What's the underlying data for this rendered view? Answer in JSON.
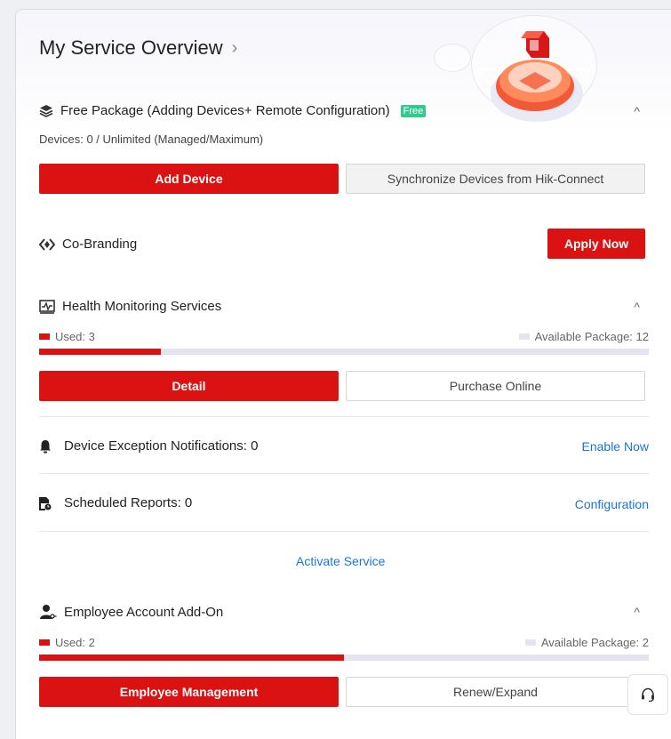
{
  "header": {
    "title": "My Service Overview",
    "chevron": "›"
  },
  "free_package": {
    "title": "Free Package (Adding Devices+ Remote Configuration)",
    "badge": "Free",
    "devices_line": "Devices: 0 / Unlimited  (Managed/Maximum)",
    "add_button": "Add Device",
    "sync_button": "Synchronize Devices from Hik-Connect",
    "collapse_icon": "^"
  },
  "co_branding": {
    "title": "Co-Branding",
    "apply_button": "Apply Now"
  },
  "health": {
    "title": "Health Monitoring Services",
    "used_label": "Used: 3",
    "available_label": "Available Package: 12",
    "used_fraction": 0.2,
    "detail_button": "Detail",
    "purchase_button": "Purchase Online",
    "collapse_icon": "^"
  },
  "exceptions": {
    "label": "Device Exception Notifications: 0",
    "link": "Enable Now"
  },
  "reports": {
    "label": "Scheduled Reports: 0",
    "link": "Configuration"
  },
  "activate_link": "Activate Service",
  "employee": {
    "title": "Employee Account Add-On",
    "used_label": "Used: 2",
    "available_label": "Available Package: 2",
    "used_fraction": 0.5,
    "manage_button": "Employee Management",
    "renew_button": "Renew/Expand",
    "collapse_icon": "^"
  },
  "colors": {
    "accent": "#db1212",
    "link": "#1a74d8",
    "available": "#e4e4f1",
    "badge": "#33c98f"
  }
}
